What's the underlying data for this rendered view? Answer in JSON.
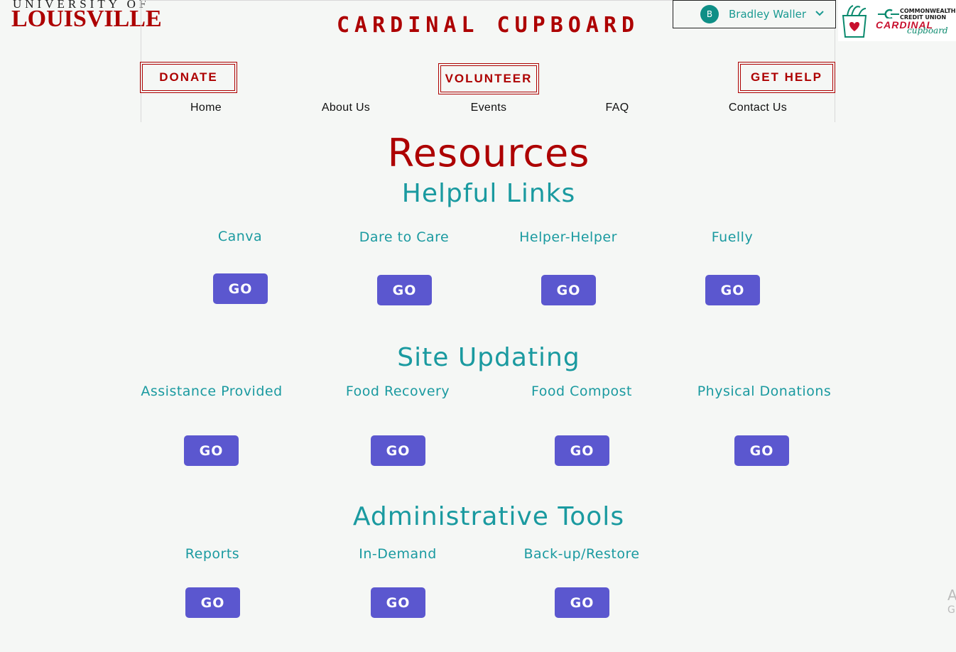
{
  "brand": {
    "university_line1": "UNIVERSITY OF",
    "university_line2": "LOUISVILLE",
    "site_title": "CARDINAL CUPBOARD",
    "partner_line1": "COMMONWEALTH",
    "partner_line2": "CREDIT UNION",
    "partner_cardinal": "CARDINAL",
    "partner_cupboard": "cupboard",
    "accent_color": "#ad0000",
    "teal_color": "#1a9aa0",
    "button_color": "#5b57cf"
  },
  "user": {
    "initial": "B",
    "name": "Bradley Waller"
  },
  "header_buttons": {
    "donate": "DONATE",
    "volunteer": "VOLUNTEER",
    "get_help": "GET HELP"
  },
  "nav": [
    "Home",
    "About Us",
    "Events",
    "FAQ",
    "Contact Us"
  ],
  "page_title": "Resources",
  "sections": {
    "helpful_links": {
      "title": "Helpful Links",
      "items": [
        "Canva",
        "Dare to Care",
        "Helper-Helper",
        "Fuelly"
      ]
    },
    "site_updating": {
      "title": "Site Updating",
      "items": [
        "Assistance Provided",
        "Food Recovery",
        "Food Compost",
        "Physical Donations"
      ]
    },
    "admin_tools": {
      "title": "Administrative Tools",
      "items": [
        "Reports",
        "In-Demand",
        "Back-up/Restore"
      ]
    }
  },
  "go_label": "GO",
  "edge_text": {
    "line1": "A",
    "line2": "G"
  }
}
